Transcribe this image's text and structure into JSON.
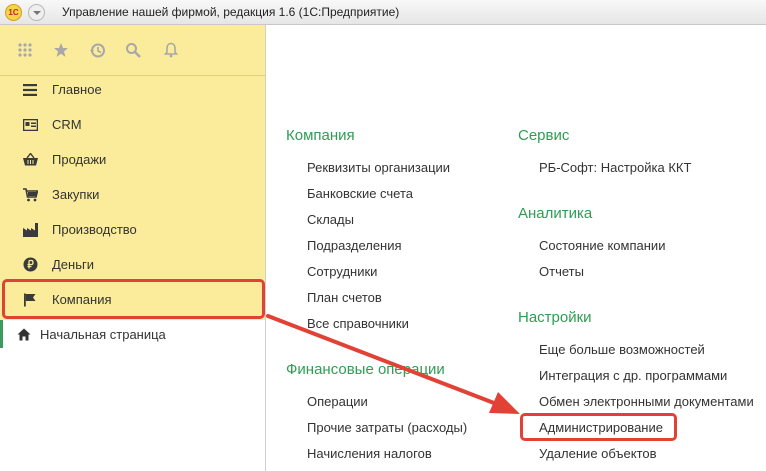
{
  "window": {
    "logo_text": "1С",
    "title": "Управление нашей фирмой, редакция 1.6  (1С:Предприятие)"
  },
  "toolbar": {
    "icons": [
      "apps-grid-icon",
      "star-icon",
      "history-icon",
      "search-icon",
      "bell-icon"
    ]
  },
  "sidebar": {
    "items": [
      {
        "label": "Главное",
        "icon": "menu-lines-icon"
      },
      {
        "label": "CRM",
        "icon": "card-icon"
      },
      {
        "label": "Продажи",
        "icon": "basket-icon"
      },
      {
        "label": "Закупки",
        "icon": "cart-icon"
      },
      {
        "label": "Производство",
        "icon": "factory-icon"
      },
      {
        "label": "Деньги",
        "icon": "ruble-icon"
      },
      {
        "label": "Компания",
        "icon": "flag-icon"
      }
    ],
    "home_label": "Начальная страница"
  },
  "sections": {
    "company": {
      "title": "Компания",
      "links": [
        "Реквизиты организации",
        "Банковские счета",
        "Склады",
        "Подразделения",
        "Сотрудники",
        "План счетов",
        "Все справочники"
      ]
    },
    "finance": {
      "title": "Финансовые операции",
      "links": [
        "Операции",
        "Прочие затраты (расходы)",
        "Начисления налогов"
      ]
    },
    "service": {
      "title": "Сервис",
      "links": [
        "РБ-Софт: Настройка ККТ"
      ]
    },
    "analytics": {
      "title": "Аналитика",
      "links": [
        "Состояние компании",
        "Отчеты"
      ]
    },
    "settings": {
      "title": "Настройки",
      "links": [
        "Еще больше возможностей",
        "Интеграция с др. программами",
        "Обмен электронными документами",
        "Администрирование",
        "Удаление объектов"
      ]
    }
  },
  "colors": {
    "sidebar_bg": "#fbec9c",
    "section_title": "#2f9d53",
    "highlight": "#e24236"
  }
}
